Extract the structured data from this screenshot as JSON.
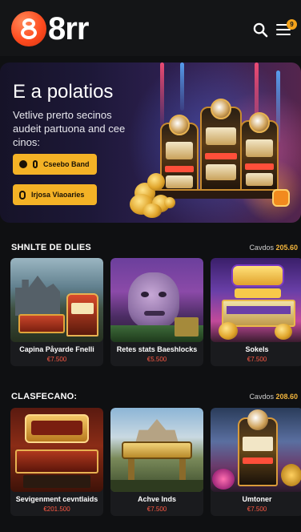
{
  "app": {
    "logo_text": "8rr",
    "notification_count": "9"
  },
  "header": {
    "search_icon": "search-icon",
    "menu_icon": "hamburger-menu-icon"
  },
  "hero": {
    "title": "E a polatios",
    "subtitle": "Vetlive prerto secinos audeit partuona and cee cinos:",
    "buttons": [
      {
        "label": "Cseebo Band",
        "icon": "pin-icon"
      },
      {
        "label": "Irjosa Viaoaries",
        "icon": "coin-icon"
      }
    ]
  },
  "sections": [
    {
      "title": "SHNLTE DE DLIES",
      "more_prefix": "Cavdos",
      "more_value": "205.60",
      "cards": [
        {
          "name": "Capina Påyarde Fnelli",
          "value": "€7.500"
        },
        {
          "name": "Retes stats Baeshlocks",
          "value": "€5.500"
        },
        {
          "name": "Sokels",
          "value": "€7.500"
        }
      ]
    },
    {
      "title": "CLASFECANO:",
      "more_prefix": "Cavdos",
      "more_value": "208.60",
      "cards": [
        {
          "name": "Sevigenment cevntlaids",
          "value": "€201.500"
        },
        {
          "name": "Achve Inds",
          "value": "€7.500"
        },
        {
          "name": "Umtoner",
          "value": "€7.500"
        }
      ]
    }
  ],
  "colors": {
    "accent": "#f4b226",
    "brand": "#ff4b1f",
    "price": "#ff5a45",
    "background": "#0f1012"
  }
}
